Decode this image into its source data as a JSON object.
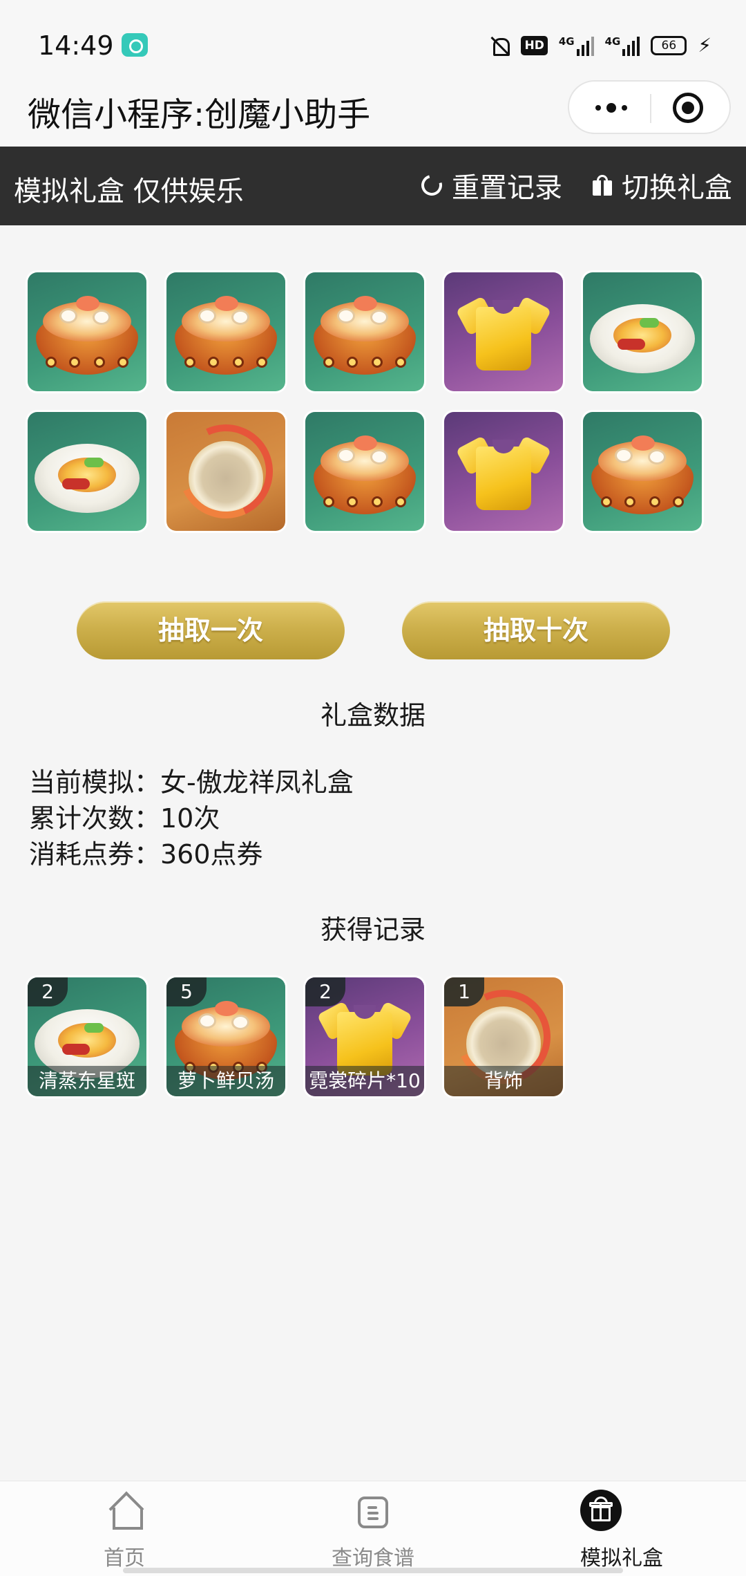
{
  "status_bar": {
    "time": "14:49",
    "hd": "HD",
    "net1": "4G",
    "net2": "4G",
    "battery": "66"
  },
  "title_bar": {
    "title": "微信小程序:创魔小助手"
  },
  "header": {
    "title": "模拟礼盒 仅供娱乐",
    "reset_label": "重置记录",
    "switch_label": "切换礼盒"
  },
  "grid": {
    "rows": [
      [
        "soup-icon",
        "soup-icon",
        "soup-icon",
        "shirt-icon",
        "fish-plate-icon"
      ],
      [
        "fish-plate-icon",
        "accessory-icon",
        "soup-icon",
        "shirt-icon",
        "soup-icon"
      ]
    ]
  },
  "buttons": {
    "draw_once": "抽取一次",
    "draw_ten": "抽取十次"
  },
  "stats": {
    "heading": "礼盒数据",
    "current": "当前模拟：女-傲龙祥凤礼盒",
    "count": "累计次数：10次",
    "cost": "消耗点券：360点券"
  },
  "records": {
    "heading": "获得记录",
    "items": [
      {
        "count": "2",
        "label": "清蒸东星斑",
        "icon": "fish-plate-icon"
      },
      {
        "count": "5",
        "label": "萝卜鲜贝汤",
        "icon": "soup-icon"
      },
      {
        "count": "2",
        "label": "霓裳碎片*10",
        "icon": "shirt-icon"
      },
      {
        "count": "1",
        "label": "背饰",
        "icon": "accessory-icon"
      }
    ]
  },
  "tabs": [
    {
      "label": "首页",
      "icon": "home-icon"
    },
    {
      "label": "查询食谱",
      "icon": "recipe-icon"
    },
    {
      "label": "模拟礼盒",
      "icon": "gift-icon"
    }
  ],
  "colors": {
    "header_bg": "#2f2f2f",
    "page_bg": "#f5f5f5",
    "button_gold": "#cdb04c",
    "tile_green": "#3e9a7a",
    "tile_purple": "#8a4f9a",
    "tile_orange": "#d89146"
  }
}
